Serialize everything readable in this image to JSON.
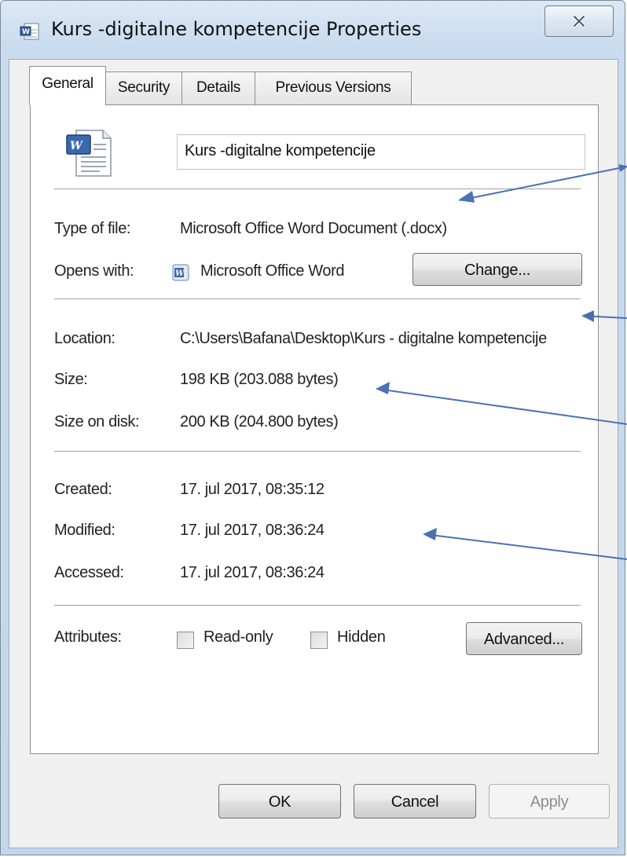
{
  "window": {
    "title": "Kurs -digitalne kompetencije Properties"
  },
  "tabs": [
    {
      "label": "General",
      "active": true
    },
    {
      "label": "Security",
      "active": false
    },
    {
      "label": "Details",
      "active": false
    },
    {
      "label": "Previous Versions",
      "active": false
    }
  ],
  "general": {
    "file_name": "Kurs -digitalne kompetencije",
    "type_of_file_label": "Type of file:",
    "type_of_file": "Microsoft Office Word Document (.docx)",
    "opens_with_label": "Opens with:",
    "opens_with": "Microsoft Office Word",
    "change_label": "Change...",
    "location_label": "Location:",
    "location": "C:\\Users\\Bafana\\Desktop\\Kurs - digitalne kompetencije",
    "size_label": "Size:",
    "size": "198 KB (203.088 bytes)",
    "size_on_disk_label": "Size on disk:",
    "size_on_disk": "200 KB (204.800 bytes)",
    "created_label": "Created:",
    "created": "17. jul 2017, 08:35:12",
    "modified_label": "Modified:",
    "modified": "17. jul 2017, 08:36:24",
    "accessed_label": "Accessed:",
    "accessed": "17. jul 2017, 08:36:24",
    "attributes_label": "Attributes:",
    "read_only_label": "Read-only",
    "read_only_checked": false,
    "hidden_label": "Hidden",
    "hidden_checked": false,
    "advanced_label": "Advanced..."
  },
  "footer": {
    "ok_label": "OK",
    "cancel_label": "Cancel",
    "apply_label": "Apply"
  },
  "colors": {
    "annotation_arrow": "#4a72b0",
    "title_bar": "#c9dbef",
    "dialog_background": "#f0f0f0"
  },
  "icons": {
    "title": "word-document-icon",
    "file": "word-document-icon",
    "app": "word-app-icon",
    "close": "close-x-icon"
  }
}
